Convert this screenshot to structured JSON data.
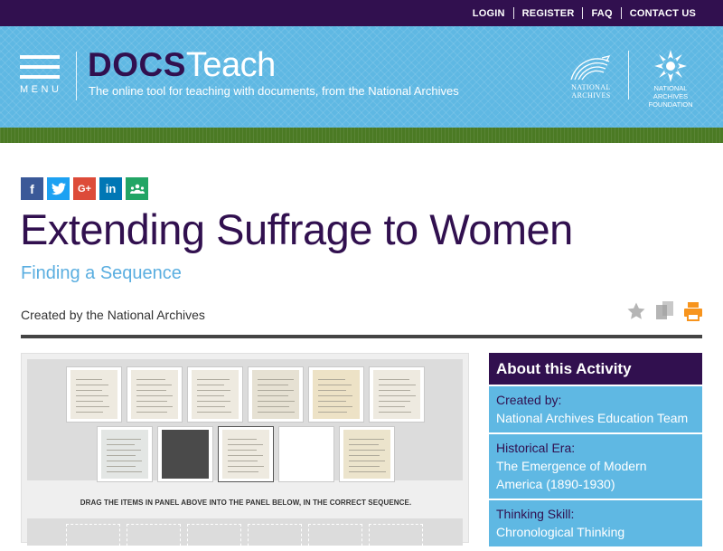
{
  "topnav": {
    "login": "LOGIN",
    "register": "REGISTER",
    "faq": "FAQ",
    "contact": "CONTACT US"
  },
  "header": {
    "menu_label": "MENU",
    "brand_bold": "DOCS",
    "brand_light": "Teach",
    "tagline": "The online tool for teaching with documents, from the National Archives",
    "na_logo_text": "NATIONAL\nARCHIVES",
    "naf_logo_text": "NATIONAL ARCHIVES\nFOUNDATION"
  },
  "share": {
    "icons": [
      "facebook-icon",
      "twitter-icon",
      "google-plus-icon",
      "linkedin-icon",
      "classroom-icon"
    ],
    "labels": {
      "facebook": "f",
      "google": "G+",
      "linkedin": "in"
    }
  },
  "page": {
    "title": "Extending Suffrage to Women",
    "subtitle": "Finding a Sequence",
    "created_by": "Created by the National Archives"
  },
  "tools": {
    "icons": [
      "favorite-star-icon",
      "copy-icon",
      "print-icon"
    ]
  },
  "activity": {
    "instruction": "DRAG THE ITEMS IN PANEL ABOVE INTO THE PANEL BELOW, IN THE CORRECT SEQUENCE."
  },
  "about": {
    "heading": "About this Activity",
    "items": [
      {
        "label": "Created by:",
        "value": "National Archives Education Team"
      },
      {
        "label": "Historical Era:",
        "value": "The Emergence of Modern America (1890-1930)"
      },
      {
        "label": "Thinking Skill:",
        "value": "Chronological Thinking"
      }
    ]
  },
  "colors": {
    "purple": "#31104f",
    "header_blue": "#5fb8e3",
    "green_band": "#4b7a24",
    "subtitle_blue": "#5aaee0",
    "print_orange": "#f7941d"
  }
}
